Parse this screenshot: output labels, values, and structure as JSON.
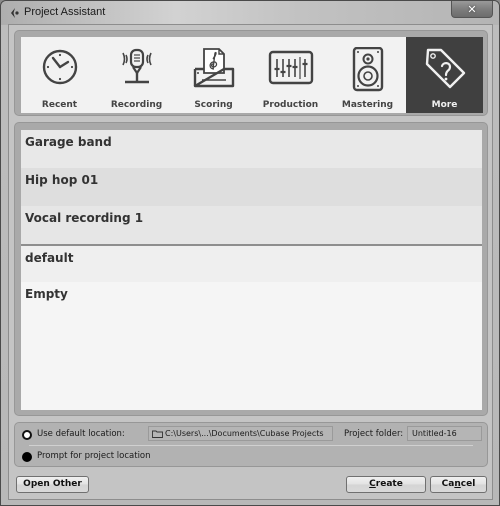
{
  "window": {
    "title": "Project Assistant",
    "close_label": "✕"
  },
  "categories": [
    {
      "label": "Recent",
      "icon": "clock-icon",
      "active": false
    },
    {
      "label": "Recording",
      "icon": "microphone-icon",
      "active": false
    },
    {
      "label": "Scoring",
      "icon": "score-printer-icon",
      "active": false
    },
    {
      "label": "Production",
      "icon": "mixer-faders-icon",
      "active": false
    },
    {
      "label": "Mastering",
      "icon": "speaker-icon",
      "active": false
    },
    {
      "label": "More",
      "icon": "tag-question-icon",
      "active": true
    }
  ],
  "templates": [
    {
      "label": "Garage band"
    },
    {
      "label": "Hip hop 01"
    },
    {
      "label": "Vocal recording 1"
    },
    {
      "label": "default"
    },
    {
      "label": "Empty"
    }
  ],
  "location": {
    "use_default_label": "Use default location:",
    "use_default_selected": false,
    "path": "C:\\Users\\...\\Documents\\Cubase Projects",
    "project_folder_label": "Project folder:",
    "project_folder_value": "Untitled-16",
    "prompt_label": "Prompt for project location",
    "prompt_selected": true
  },
  "buttons": {
    "open_other": "Open Other",
    "create_prefix": "",
    "create_mnemonic": "C",
    "create_rest": "reate",
    "cancel_prefix": "Ca",
    "cancel_mnemonic": "n",
    "cancel_rest": "cel"
  }
}
